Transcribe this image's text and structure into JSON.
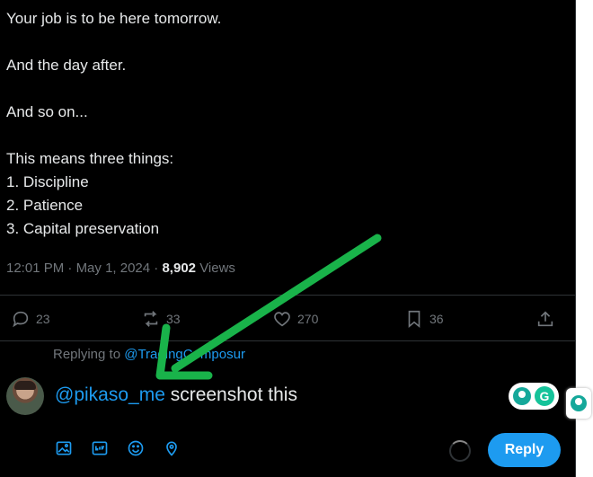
{
  "tweet": {
    "lines": [
      "Your job is to be here tomorrow.",
      "And the day after.",
      "And so on...",
      "This means three things:",
      "1. Discipline",
      "2. Patience",
      "3. Capital preservation"
    ],
    "time": "12:01 PM",
    "date": "May 1, 2024",
    "views_count": "8,902",
    "views_label": "Views"
  },
  "actions": {
    "replies": "23",
    "reposts": "33",
    "likes": "270",
    "bookmarks": "36"
  },
  "reply": {
    "replying_to_label": "Replying to",
    "replying_to_handle": "@TradingComposur",
    "mention": "@pikaso_me",
    "text": " screenshot this",
    "button_label": "Reply"
  },
  "icons": {
    "reply": "comment-icon",
    "repost": "repost-icon",
    "like": "heart-icon",
    "bookmark": "bookmark-icon",
    "share": "share-icon",
    "toolbar": [
      "image-icon",
      "gif-icon",
      "emoji-icon",
      "location-icon"
    ]
  },
  "colors": {
    "accent": "#1d9bf0",
    "annotation_arrow": "#19b34a",
    "grammarly": "#15c39a"
  },
  "extension": {
    "grammarly_letter": "G"
  }
}
